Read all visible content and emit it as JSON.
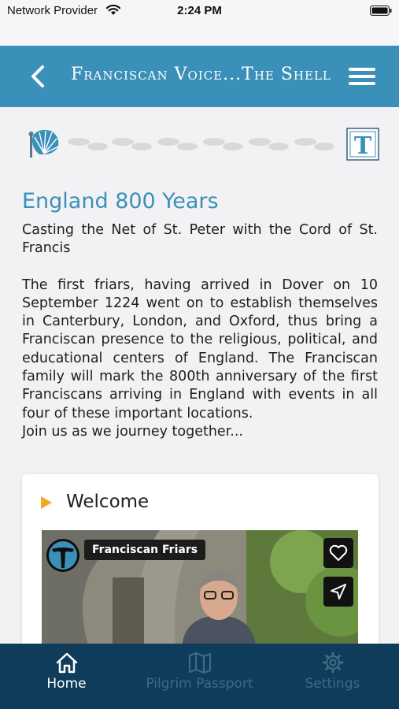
{
  "status_bar": {
    "carrier": "Network Provider",
    "time": "2:24 PM",
    "wifi_icon": "wifi-icon",
    "battery_icon": "battery-icon"
  },
  "nav": {
    "title": "Franciscan Voice...The Shell",
    "back_icon": "chevron-left-icon",
    "menu_icon": "hamburger-menu-icon",
    "background_color": "#3b90b9"
  },
  "progress": {
    "start_icon": "scallop-shell-icon",
    "step_icon": "footprints-icon",
    "end_icon": "tau-cross-icon",
    "steps_count": 6
  },
  "article": {
    "title": "England 800 Years",
    "subtitle": "Casting the Net of St. Peter with the Cord of St. Francis",
    "body": "The first friars, having arrived in Dover on 10 September 1224 went on to establish themselves in Canterbury, London, and Oxford, thus bring a Franciscan presence to the religious, political, and educational centers of England. The Franciscan family will mark the 800th anniversary of the first Franciscans arriving in England with events in all four of these important locations.",
    "closing": "Join us as we journey together...",
    "title_color": "#3b90b9"
  },
  "welcome_card": {
    "title": "Welcome",
    "indicator_icon": "play-triangle-icon",
    "indicator_color": "#f5a623",
    "video": {
      "channel_name": "Franciscan Friars",
      "avatar_icon": "tau-logo-icon",
      "like_icon": "heart-icon",
      "share_icon": "send-icon"
    }
  },
  "tabs": [
    {
      "label": "Home",
      "icon": "home-icon",
      "active": true
    },
    {
      "label": "Pilgrim Passport",
      "icon": "map-icon",
      "active": false
    },
    {
      "label": "Settings",
      "icon": "gear-icon",
      "active": false
    }
  ],
  "tab_bar_color": "#0e3c5a"
}
